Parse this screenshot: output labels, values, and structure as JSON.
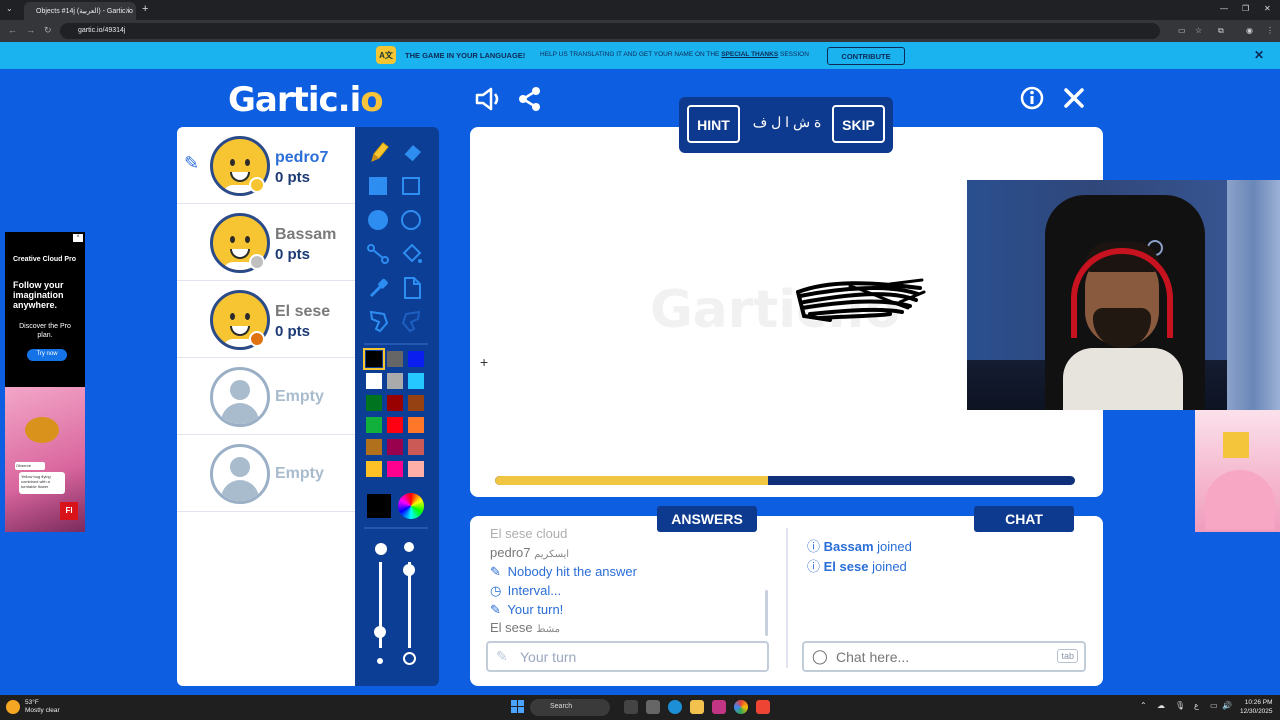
{
  "browser": {
    "tab_title": "Objects #14j (العربية) - Gartic.io",
    "url": "gartic.io/49314j",
    "new_tab": "+",
    "tab_close": "×"
  },
  "banner": {
    "headline": "THE GAME IN YOUR LANGUAGE!",
    "body_prefix": "HELP US TRANSLATING IT AND GET YOUR NAME ON THE",
    "body_link": "SPECIAL THANKS",
    "body_suffix": "SESSION",
    "contribute": "CONTRIBUTE",
    "globe": "A文"
  },
  "logo": {
    "text_main": "Gartic.i",
    "text_end": "o"
  },
  "ad": {
    "brand": "Creative Cloud Pro",
    "headline": "Follow your imagination anywhere.",
    "sub": "Discover the Pro plan.",
    "cta": "Try now",
    "card_small": "Observe",
    "card_text": "Yellow bug flying combined with a turntable flower",
    "logo": "Fl"
  },
  "players": [
    {
      "name": "pedro7",
      "pts": "0 pts",
      "drawing": true,
      "dot": "#f7c531",
      "name_color": "#2a6ed8",
      "empty": false
    },
    {
      "name": "Bassam",
      "pts": "0 pts",
      "drawing": false,
      "dot": "#bfbfbf",
      "name_color": "#7a7a7a",
      "empty": false
    },
    {
      "name": "El sese",
      "pts": "0 pts",
      "drawing": false,
      "dot": "#e0730f",
      "name_color": "#7a7a7a",
      "empty": false
    },
    {
      "name": "Empty",
      "pts": "",
      "empty": true,
      "name_color": "#a9bccd"
    },
    {
      "name": "Empty",
      "pts": "",
      "empty": true,
      "name_color": "#a9bccd"
    }
  ],
  "palette": [
    "#000000",
    "#666666",
    "#0b1ef0",
    "#ffffff",
    "#aaaaaa",
    "#26c9ff",
    "#017420",
    "#990000",
    "#964112",
    "#11b03c",
    "#ff0013",
    "#ff7829",
    "#b0701c",
    "#99004e",
    "#cb5a57",
    "#ffc126",
    "#ff008f",
    "#feafa8"
  ],
  "current_color": "#000000",
  "hint": {
    "hint_label": "HINT",
    "word": "ة ش ا ل ف",
    "skip_label": "SKIP"
  },
  "canvas": {
    "watermark": "Gartic.io",
    "time_progress": 0.47
  },
  "answers": {
    "tab_label": "ANSWERS",
    "messages": [
      {
        "type": "user",
        "user": "El sese",
        "text": "cloud"
      },
      {
        "type": "user",
        "user": "pedro7",
        "text": "ايسكريم"
      },
      {
        "type": "sys",
        "icon": "pencil",
        "text": "Nobody hit the answer"
      },
      {
        "type": "sys",
        "icon": "clock",
        "text": "Interval..."
      },
      {
        "type": "sys",
        "icon": "pencil",
        "text": "Your turn!"
      },
      {
        "type": "user",
        "user": "El sese",
        "text": "مشط"
      }
    ],
    "input_placeholder": "Your turn"
  },
  "chat": {
    "tab_label": "CHAT",
    "messages": [
      {
        "user": "Bassam",
        "text": "joined"
      },
      {
        "user": "El sese",
        "text": "joined"
      }
    ],
    "input_placeholder": "Chat here...",
    "tab_hint": "tab"
  },
  "taskbar": {
    "temp": "53°F",
    "weather": "Mostly clear",
    "search": "Search",
    "time": "10:26 PM",
    "date": "12/30/2025"
  }
}
